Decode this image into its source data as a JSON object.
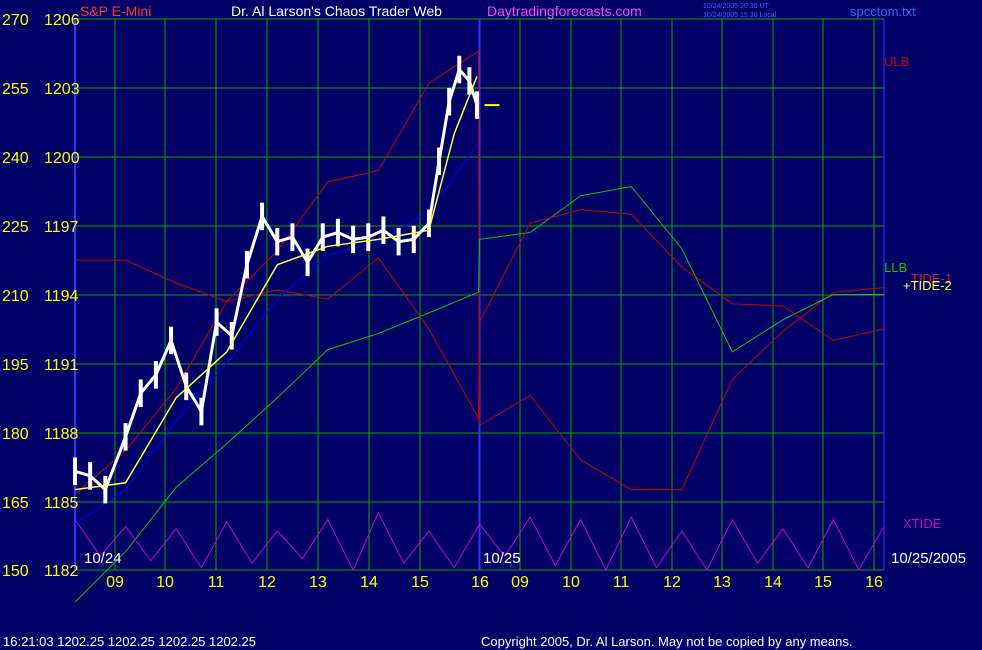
{
  "header": {
    "instrument": "S&P E-Mini",
    "site_title": "Dr. Al Larson's Chaos Trader Web",
    "site_url": "Daytradingforecasts.com",
    "time_ut": "10/24/2005 20:30 UT",
    "time_local": "10/24/2005 15:30 Local",
    "file_name": "spcctom.txt"
  },
  "footer": {
    "status": "16:21:03  1202.25 1202.25 1202.25 1202.25",
    "copyright": "Copyright 2005, Dr. Al Larson. May not be copied by any means."
  },
  "colors": {
    "background": "#000066",
    "grid": "#00aa00",
    "axis_text": "#ffff00",
    "ulb": "#cc0000",
    "llb": "#00cc00",
    "xtide": "#cc00cc",
    "price_bars": "#ffffff",
    "fast_avg": "#ffff44",
    "slow_avg": "#0000ff",
    "divider": "#3333ff"
  },
  "chart_data": {
    "type": "line",
    "title": "S&P E-Mini",
    "left_axis_ticks": [
      "270",
      "255",
      "240",
      "225",
      "210",
      "195",
      "180",
      "165",
      "150"
    ],
    "price_axis_ticks": [
      "1206",
      "1203",
      "1200",
      "1197",
      "1194",
      "1191",
      "1188",
      "1185",
      "1182"
    ],
    "ylim_left": [
      150,
      270
    ],
    "ylim_price": [
      1182,
      1206
    ],
    "x_hour_labels": [
      "09",
      "10",
      "11",
      "12",
      "13",
      "14",
      "15",
      "16",
      "09",
      "10",
      "11",
      "12",
      "13",
      "14",
      "15",
      "16"
    ],
    "date_labels": [
      "10/24",
      "10/25",
      "10/25/2005"
    ],
    "series_labels": [
      "ULB",
      "LLB",
      "TIDE-1",
      "+TIDE-2",
      "XTIDE"
    ],
    "last_price": 1202.25,
    "series": [
      {
        "name": "ULB",
        "x": [
          0,
          1,
          2,
          3,
          4,
          5,
          6,
          7,
          7.98,
          8,
          9,
          10,
          11,
          12,
          13,
          14,
          15,
          16
        ],
        "y": [
          1185.3,
          1187.2,
          1189.9,
          1193.7,
          1195.9,
          1198.9,
          1199.4,
          1203.2,
          1204.6,
          1188.3,
          1189.6,
          1186.8,
          1185.5,
          1185.5,
          1190.3,
          1192.4,
          1194.1,
          1194.3
        ]
      },
      {
        "name": "LLB",
        "x": [
          0,
          1,
          2,
          3,
          4,
          5,
          6,
          7,
          7.98,
          8,
          9,
          10,
          11,
          12,
          13,
          14,
          15,
          16
        ],
        "y": [
          1180.6,
          1182.8,
          1185.6,
          1187.5,
          1189.5,
          1191.6,
          1192.3,
          1193.2,
          1194.1,
          1196.4,
          1196.7,
          1198.3,
          1198.7,
          1196.0,
          1191.5,
          1192.9,
          1194.0,
          1194.0
        ]
      },
      {
        "name": "TIDE-1",
        "x": [
          0,
          1,
          2,
          3,
          4,
          5,
          6,
          7,
          7.98,
          8,
          9,
          10,
          11,
          12,
          13,
          14,
          15,
          16
        ],
        "y": [
          1195.5,
          1195.5,
          1194.5,
          1193.7,
          1194.2,
          1193.8,
          1195.6,
          1192.5,
          1188.6,
          1192.8,
          1197.1,
          1197.7,
          1197.5,
          1195.2,
          1193.6,
          1193.5,
          1192.0,
          1192.5
        ]
      },
      {
        "name": "XTIDE",
        "x": [
          0,
          0.5,
          1,
          1.5,
          2,
          2.5,
          3,
          3.5,
          4,
          4.5,
          5,
          5.5,
          6,
          6.5,
          7,
          7.5,
          8,
          8.5,
          9,
          9.5,
          10,
          10.5,
          11,
          11.5,
          12,
          12.5,
          13,
          13.5,
          14,
          14.5,
          15,
          15.5,
          16
        ],
        "y": [
          1184.2,
          1182.6,
          1183.9,
          1182.4,
          1183.8,
          1182.1,
          1184.1,
          1182.3,
          1183.7,
          1182.5,
          1184.2,
          1182.0,
          1184.5,
          1182.3,
          1183.7,
          1182.1,
          1184.0,
          1182.6,
          1184.3,
          1182.2,
          1184.2,
          1182.0,
          1184.3,
          1182.1,
          1183.7,
          1182.0,
          1184.2,
          1182.3,
          1183.8,
          1182.1,
          1184.2,
          1182.0,
          1183.9
        ]
      },
      {
        "name": "Price",
        "x": [
          0,
          0.3,
          0.6,
          1,
          1.3,
          1.6,
          1.9,
          2.2,
          2.5,
          2.8,
          3.1,
          3.4,
          3.7,
          4,
          4.3,
          4.6,
          4.9,
          5.2,
          5.5,
          5.8,
          6.1,
          6.4,
          6.7,
          7,
          7.2,
          7.4,
          7.6,
          7.8,
          7.95
        ],
        "y": [
          1186.3,
          1186.1,
          1185.5,
          1187.8,
          1189.7,
          1190.5,
          1192.0,
          1190.0,
          1188.9,
          1192.8,
          1192.2,
          1195.3,
          1197.4,
          1196.3,
          1196.5,
          1195.4,
          1196.5,
          1196.7,
          1196.4,
          1196.5,
          1196.8,
          1196.3,
          1196.4,
          1197.1,
          1199.8,
          1202.4,
          1203.8,
          1203.3,
          1202.25
        ]
      },
      {
        "name": "Fast MA",
        "x": [
          0,
          1,
          2,
          3,
          4,
          5,
          6,
          7,
          7.5,
          7.95
        ],
        "y": [
          1185.5,
          1185.8,
          1189.5,
          1191.5,
          1195.3,
          1196.1,
          1196.4,
          1196.8,
          1201.0,
          1203.5
        ]
      },
      {
        "name": "Slow MA",
        "x": [
          0,
          1,
          2,
          3,
          4,
          5,
          6,
          7,
          7.95
        ],
        "y": [
          1184.0,
          1185.5,
          1188.5,
          1191.0,
          1193.8,
          1195.7,
          1196.3,
          1197.6,
          1200.5
        ]
      }
    ]
  }
}
